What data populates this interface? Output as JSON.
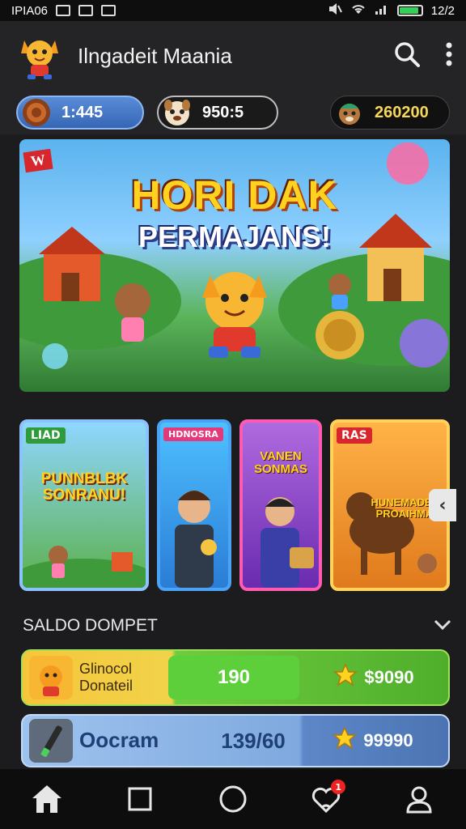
{
  "status_bar": {
    "left_text": "IPIA06",
    "right_text": "12/2",
    "battery_level": 0.9
  },
  "header": {
    "title": "Ilngadeit Maania",
    "search_icon": "search-icon",
    "menu_icon": "more-vertical-icon"
  },
  "balances": [
    {
      "value": "1:445",
      "icon": "coin-icon"
    },
    {
      "value": "950:5",
      "icon": "character-avatar-icon"
    },
    {
      "value": "260200",
      "icon": "character-avatar-icon"
    }
  ],
  "banner": {
    "badge": "W",
    "title": "HORI DAK",
    "subtitle": "PERMAJANS!"
  },
  "cards": [
    {
      "tag": "LIAD",
      "text": "PUNNBLBK SONRANU!"
    },
    {
      "tag": "HDNOSRA",
      "text": ""
    },
    {
      "tag": "",
      "text": "VANEN SONMAS"
    },
    {
      "tag": "RAS",
      "text": "HUNEMADEL PROAIHMA"
    }
  ],
  "section": {
    "title": "SALDO DOMPET"
  },
  "wallet_rows": [
    {
      "label_line1": "Glinocol",
      "label_line2": "Donateil",
      "middle": "190",
      "right": "$9090"
    },
    {
      "label_line1": "Oocram",
      "label_line2": "",
      "middle": "139/60",
      "right": "99990"
    }
  ],
  "nav": {
    "items": [
      "home-icon",
      "square-icon",
      "circle-icon",
      "notification-icon",
      "profile-icon"
    ],
    "badge_count": "1"
  },
  "colors": {
    "background": "#1c1c1e",
    "accent_yellow": "#ffd21f",
    "accent_green": "#4fae2b",
    "accent_blue": "#3567b5"
  }
}
